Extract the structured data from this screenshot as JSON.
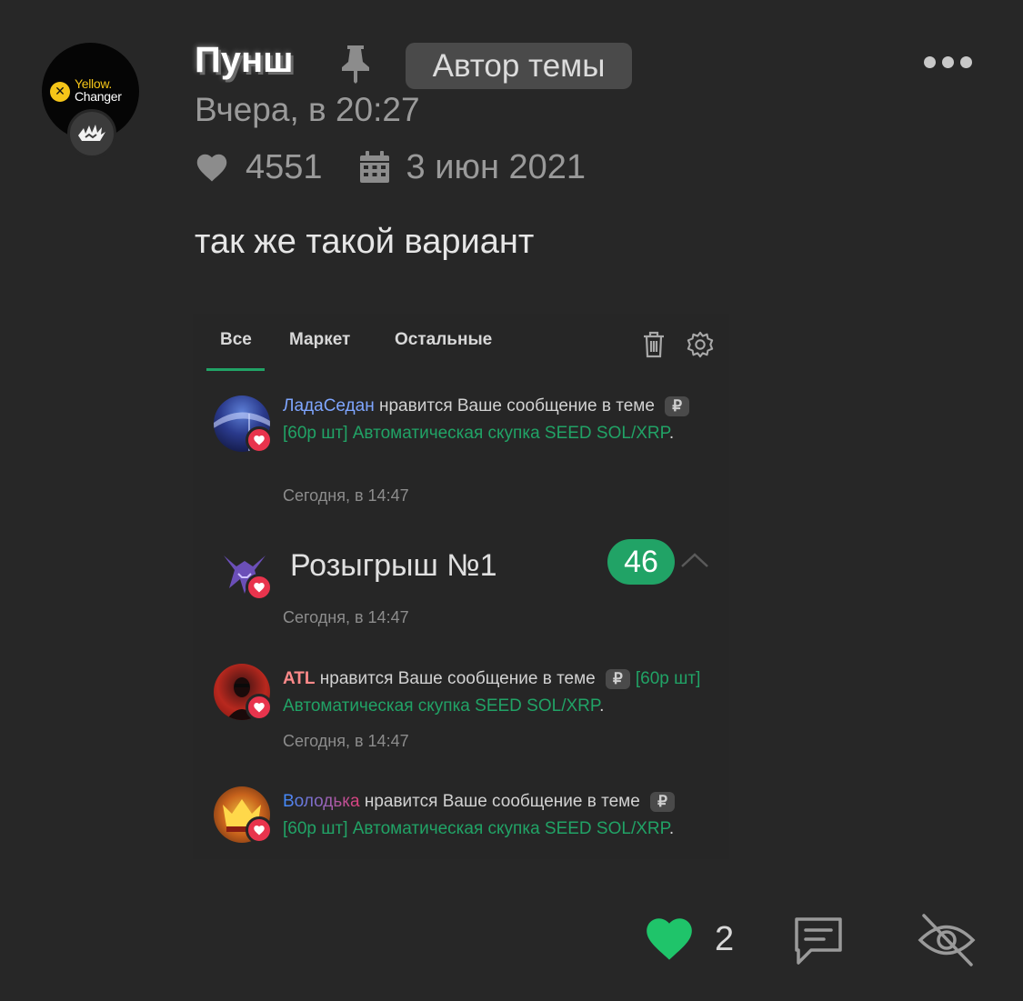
{
  "post": {
    "avatar_logo": "Yellow. Changer",
    "username": "Пунш",
    "author_badge": "Автор темы",
    "time": "Вчера, в 20:27",
    "likes": "4551",
    "date": "3 июн 2021",
    "text": "так же такой вариант"
  },
  "screenshot": {
    "tabs": [
      {
        "label": "Все",
        "active": true
      },
      {
        "label": "Маркет",
        "active": false
      },
      {
        "label": "Остальные",
        "active": false
      }
    ],
    "notifications": [
      {
        "user": "ЛадаСедан",
        "user_color": "#7fa6ff",
        "action": " нравится Ваше сообщение в теме ",
        "ruble": "₽",
        "topic": "[60р шт] Автоматическая скупка SEED SOL/XRP",
        "end": ".",
        "time": "Сегодня, в 14:47"
      },
      {
        "title": "Розыгрыш №1",
        "count": "46",
        "time": "Сегодня, в 14:47"
      },
      {
        "user": "ATL",
        "user_color": "#ff8a8a",
        "action": " нравится Ваше сообщение в теме ",
        "ruble": "₽",
        "topic": "[60р шт] Автоматическая скупка SEED SOL/XRP",
        "end": ".",
        "time": "Сегодня, в 14:47"
      },
      {
        "user": "Володька",
        "user_color": "#4a8cff",
        "action": " нравится Ваше сообщение в теме ",
        "ruble": "₽",
        "topic": "[60р шт] Автоматическая скупка SEED SOL/XRP",
        "end": "."
      }
    ]
  },
  "actions": {
    "like_count": "2"
  },
  "colors": {
    "background": "#272727",
    "accent_green": "#21a366",
    "heart_green": "#1fc46a",
    "like_badge": "#e8344d"
  },
  "icons": [
    "pin-icon",
    "more-icon",
    "heart-icon",
    "calendar-icon",
    "trash-icon",
    "gear-icon",
    "chevron-up-icon",
    "reply-icon",
    "eye-off-icon"
  ]
}
